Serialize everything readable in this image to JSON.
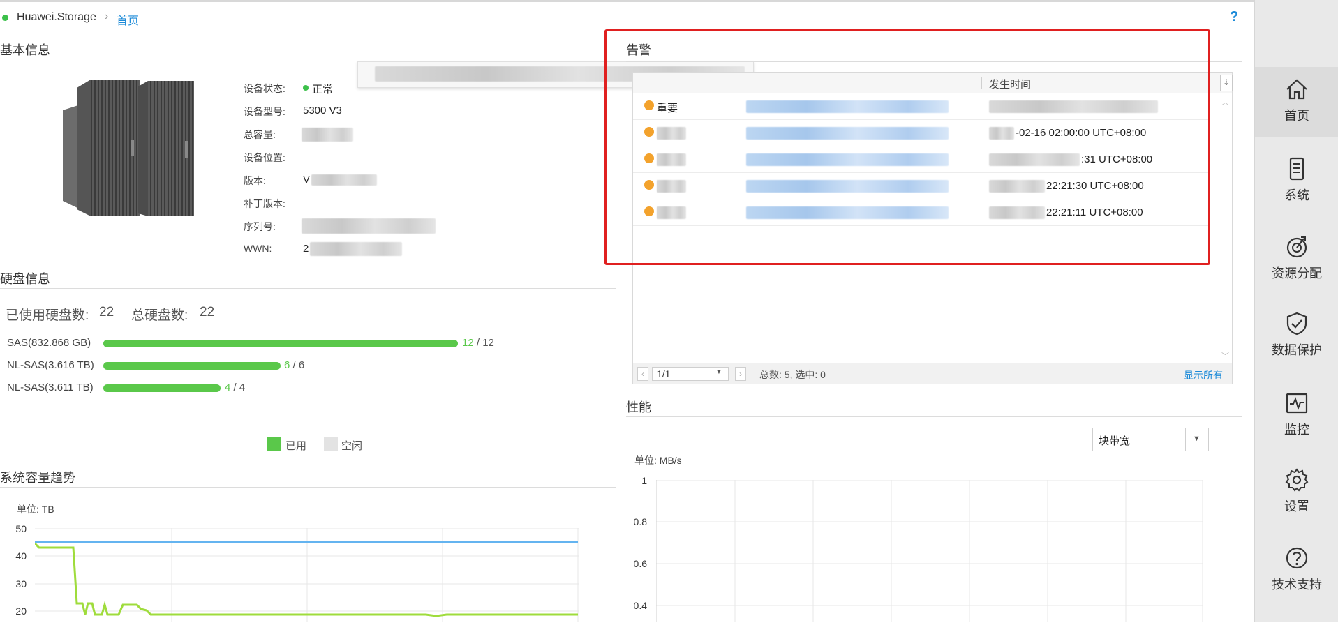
{
  "breadcrumb": {
    "root": "Huawei.Storage",
    "current": "首页"
  },
  "help_label": "?",
  "basic_info": {
    "title": "基本信息",
    "fields": [
      {
        "label": "设备状态:",
        "value": "正常",
        "status_color": "#3cc04a"
      },
      {
        "label": "设备型号:",
        "value": "5300 V3"
      },
      {
        "label": "总容量:",
        "value": ""
      },
      {
        "label": "设备位置:",
        "value": ""
      },
      {
        "label": "版本:",
        "value": "V"
      },
      {
        "label": "补丁版本:",
        "value": ""
      },
      {
        "label": "序列号:",
        "value": ""
      },
      {
        "label": "WWN:",
        "value": "2"
      }
    ]
  },
  "disk_info": {
    "title": "硬盘信息",
    "used_count_label": "已使用硬盘数:",
    "used_count": "22",
    "total_count_label": "总硬盘数:",
    "total_count": "22",
    "rows": [
      {
        "label": "SAS(832.868 GB)",
        "used": "12",
        "total": "12",
        "fraction": 1.0
      },
      {
        "label": "NL-SAS(3.616 TB)",
        "used": "6",
        "total": "6",
        "fraction": 1.0
      },
      {
        "label": "NL-SAS(3.611 TB)",
        "used": "4",
        "total": "4",
        "fraction": 1.0
      }
    ],
    "legend": {
      "used": "已用",
      "free": "空闲"
    }
  },
  "capacity_trend": {
    "title": "系统容量趋势",
    "unit": "单位: TB",
    "y_ticks": [
      "50",
      "40",
      "30",
      "20"
    ]
  },
  "alarms": {
    "title": "告警",
    "columns": {
      "time": "发生时间"
    },
    "rows": [
      {
        "severity": "重要",
        "time": ""
      },
      {
        "severity": "",
        "time": "-02-16 02:00:00 UTC+08:00"
      },
      {
        "severity": "",
        "time": ":31 UTC+08:00"
      },
      {
        "severity": "",
        "time": "22:21:30 UTC+08:00"
      },
      {
        "severity": "",
        "time": "22:21:11 UTC+08:00"
      }
    ],
    "page_value": "1/1",
    "summary": "总数: 5, 选中: 0",
    "show_all": "显示所有"
  },
  "performance": {
    "title": "性能",
    "metric_select": "块带宽",
    "unit": "单位: MB/s",
    "y_ticks": [
      "1",
      "0.8",
      "0.6",
      "0.4"
    ]
  },
  "sidebar": {
    "items": [
      {
        "label": "首页",
        "icon": "home-icon"
      },
      {
        "label": "系统",
        "icon": "server-icon"
      },
      {
        "label": "资源分配",
        "icon": "resource-icon"
      },
      {
        "label": "数据保护",
        "icon": "shield-icon"
      },
      {
        "label": "监控",
        "icon": "monitor-icon"
      },
      {
        "label": "设置",
        "icon": "gear-icon"
      },
      {
        "label": "技术支持",
        "icon": "support-icon"
      }
    ]
  },
  "colors": {
    "accent": "#1b8ad8",
    "ok": "#3cc04a",
    "bar": "#5ac84a",
    "alarm_box": "#e02020",
    "trend_total": "#64b4f0",
    "trend_used": "#9fdc3c"
  }
}
